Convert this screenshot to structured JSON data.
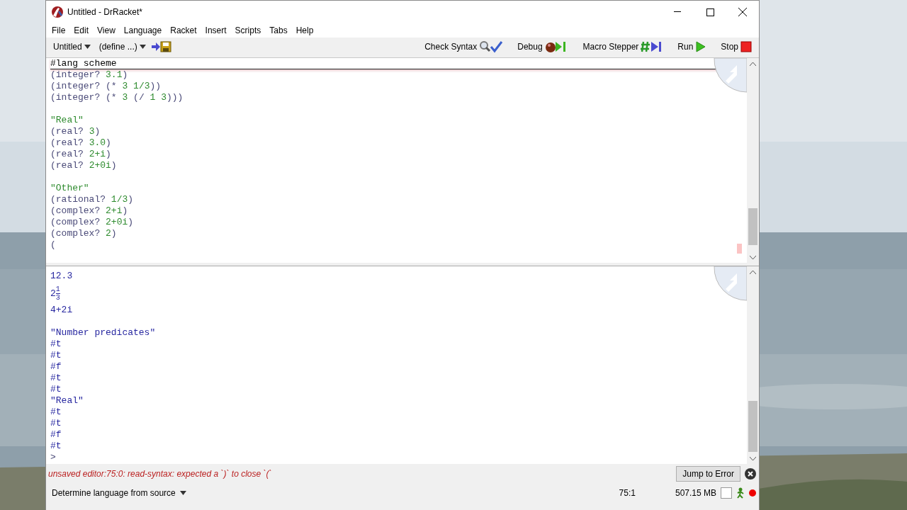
{
  "window": {
    "title": "Untitled - DrRacket*"
  },
  "menu": [
    "File",
    "Edit",
    "View",
    "Language",
    "Racket",
    "Insert",
    "Scripts",
    "Tabs",
    "Help"
  ],
  "toolbar": {
    "file_dropdown": "Untitled",
    "define_dropdown": "(define ...)",
    "buttons": [
      {
        "kind": "check",
        "label": "Check Syntax"
      },
      {
        "kind": "debug",
        "label": "Debug"
      },
      {
        "kind": "macro",
        "label": "Macro Stepper"
      },
      {
        "kind": "run",
        "label": "Run"
      },
      {
        "kind": "stop",
        "label": "Stop"
      }
    ]
  },
  "definitions": {
    "header": "#lang scheme",
    "lines": [
      {
        "kind": "code",
        "text": "(integer? 3.1)"
      },
      {
        "kind": "code",
        "text": "(integer? (* 3 1/3))"
      },
      {
        "kind": "code",
        "text": "(integer? (* 3 (/ 1 3)))"
      },
      {
        "kind": "blank"
      },
      {
        "kind": "code",
        "text": "\"Real\""
      },
      {
        "kind": "code",
        "text": "(real? 3)"
      },
      {
        "kind": "code",
        "text": "(real? 3.0)"
      },
      {
        "kind": "code",
        "text": "(real? 2+i)"
      },
      {
        "kind": "code",
        "text": "(real? 2+0i)"
      },
      {
        "kind": "blank"
      },
      {
        "kind": "code",
        "text": "\"Other\""
      },
      {
        "kind": "code",
        "text": "(rational? 1/3)"
      },
      {
        "kind": "code",
        "text": "(complex? 2+i)"
      },
      {
        "kind": "code",
        "text": "(complex? 2+0i)"
      },
      {
        "kind": "code",
        "text": "(complex? 2)"
      },
      {
        "kind": "code",
        "text": "("
      }
    ]
  },
  "interactions": {
    "lines": [
      {
        "kind": "value",
        "text": "12.3"
      },
      {
        "kind": "fraction",
        "whole": "2",
        "numerator": "1",
        "denominator": "3"
      },
      {
        "kind": "value",
        "text": "4+2i"
      },
      {
        "kind": "blank"
      },
      {
        "kind": "value",
        "text": "\"Number predicates\""
      },
      {
        "kind": "value",
        "text": "#t"
      },
      {
        "kind": "value",
        "text": "#t"
      },
      {
        "kind": "value",
        "text": "#f"
      },
      {
        "kind": "value",
        "text": "#t"
      },
      {
        "kind": "value",
        "text": "#t"
      },
      {
        "kind": "value",
        "text": "\"Real\""
      },
      {
        "kind": "value",
        "text": "#t"
      },
      {
        "kind": "value",
        "text": "#t"
      },
      {
        "kind": "value",
        "text": "#f"
      },
      {
        "kind": "value",
        "text": "#t"
      },
      {
        "kind": "prompt",
        "text": ">"
      }
    ]
  },
  "error_bar": {
    "message": "unsaved editor:75:0: read-syntax: expected a `)` to close `(`",
    "button": "Jump to Error"
  },
  "status_bar": {
    "language": "Determine language from source",
    "position": "75:1",
    "memory": "507.15 MB"
  }
}
